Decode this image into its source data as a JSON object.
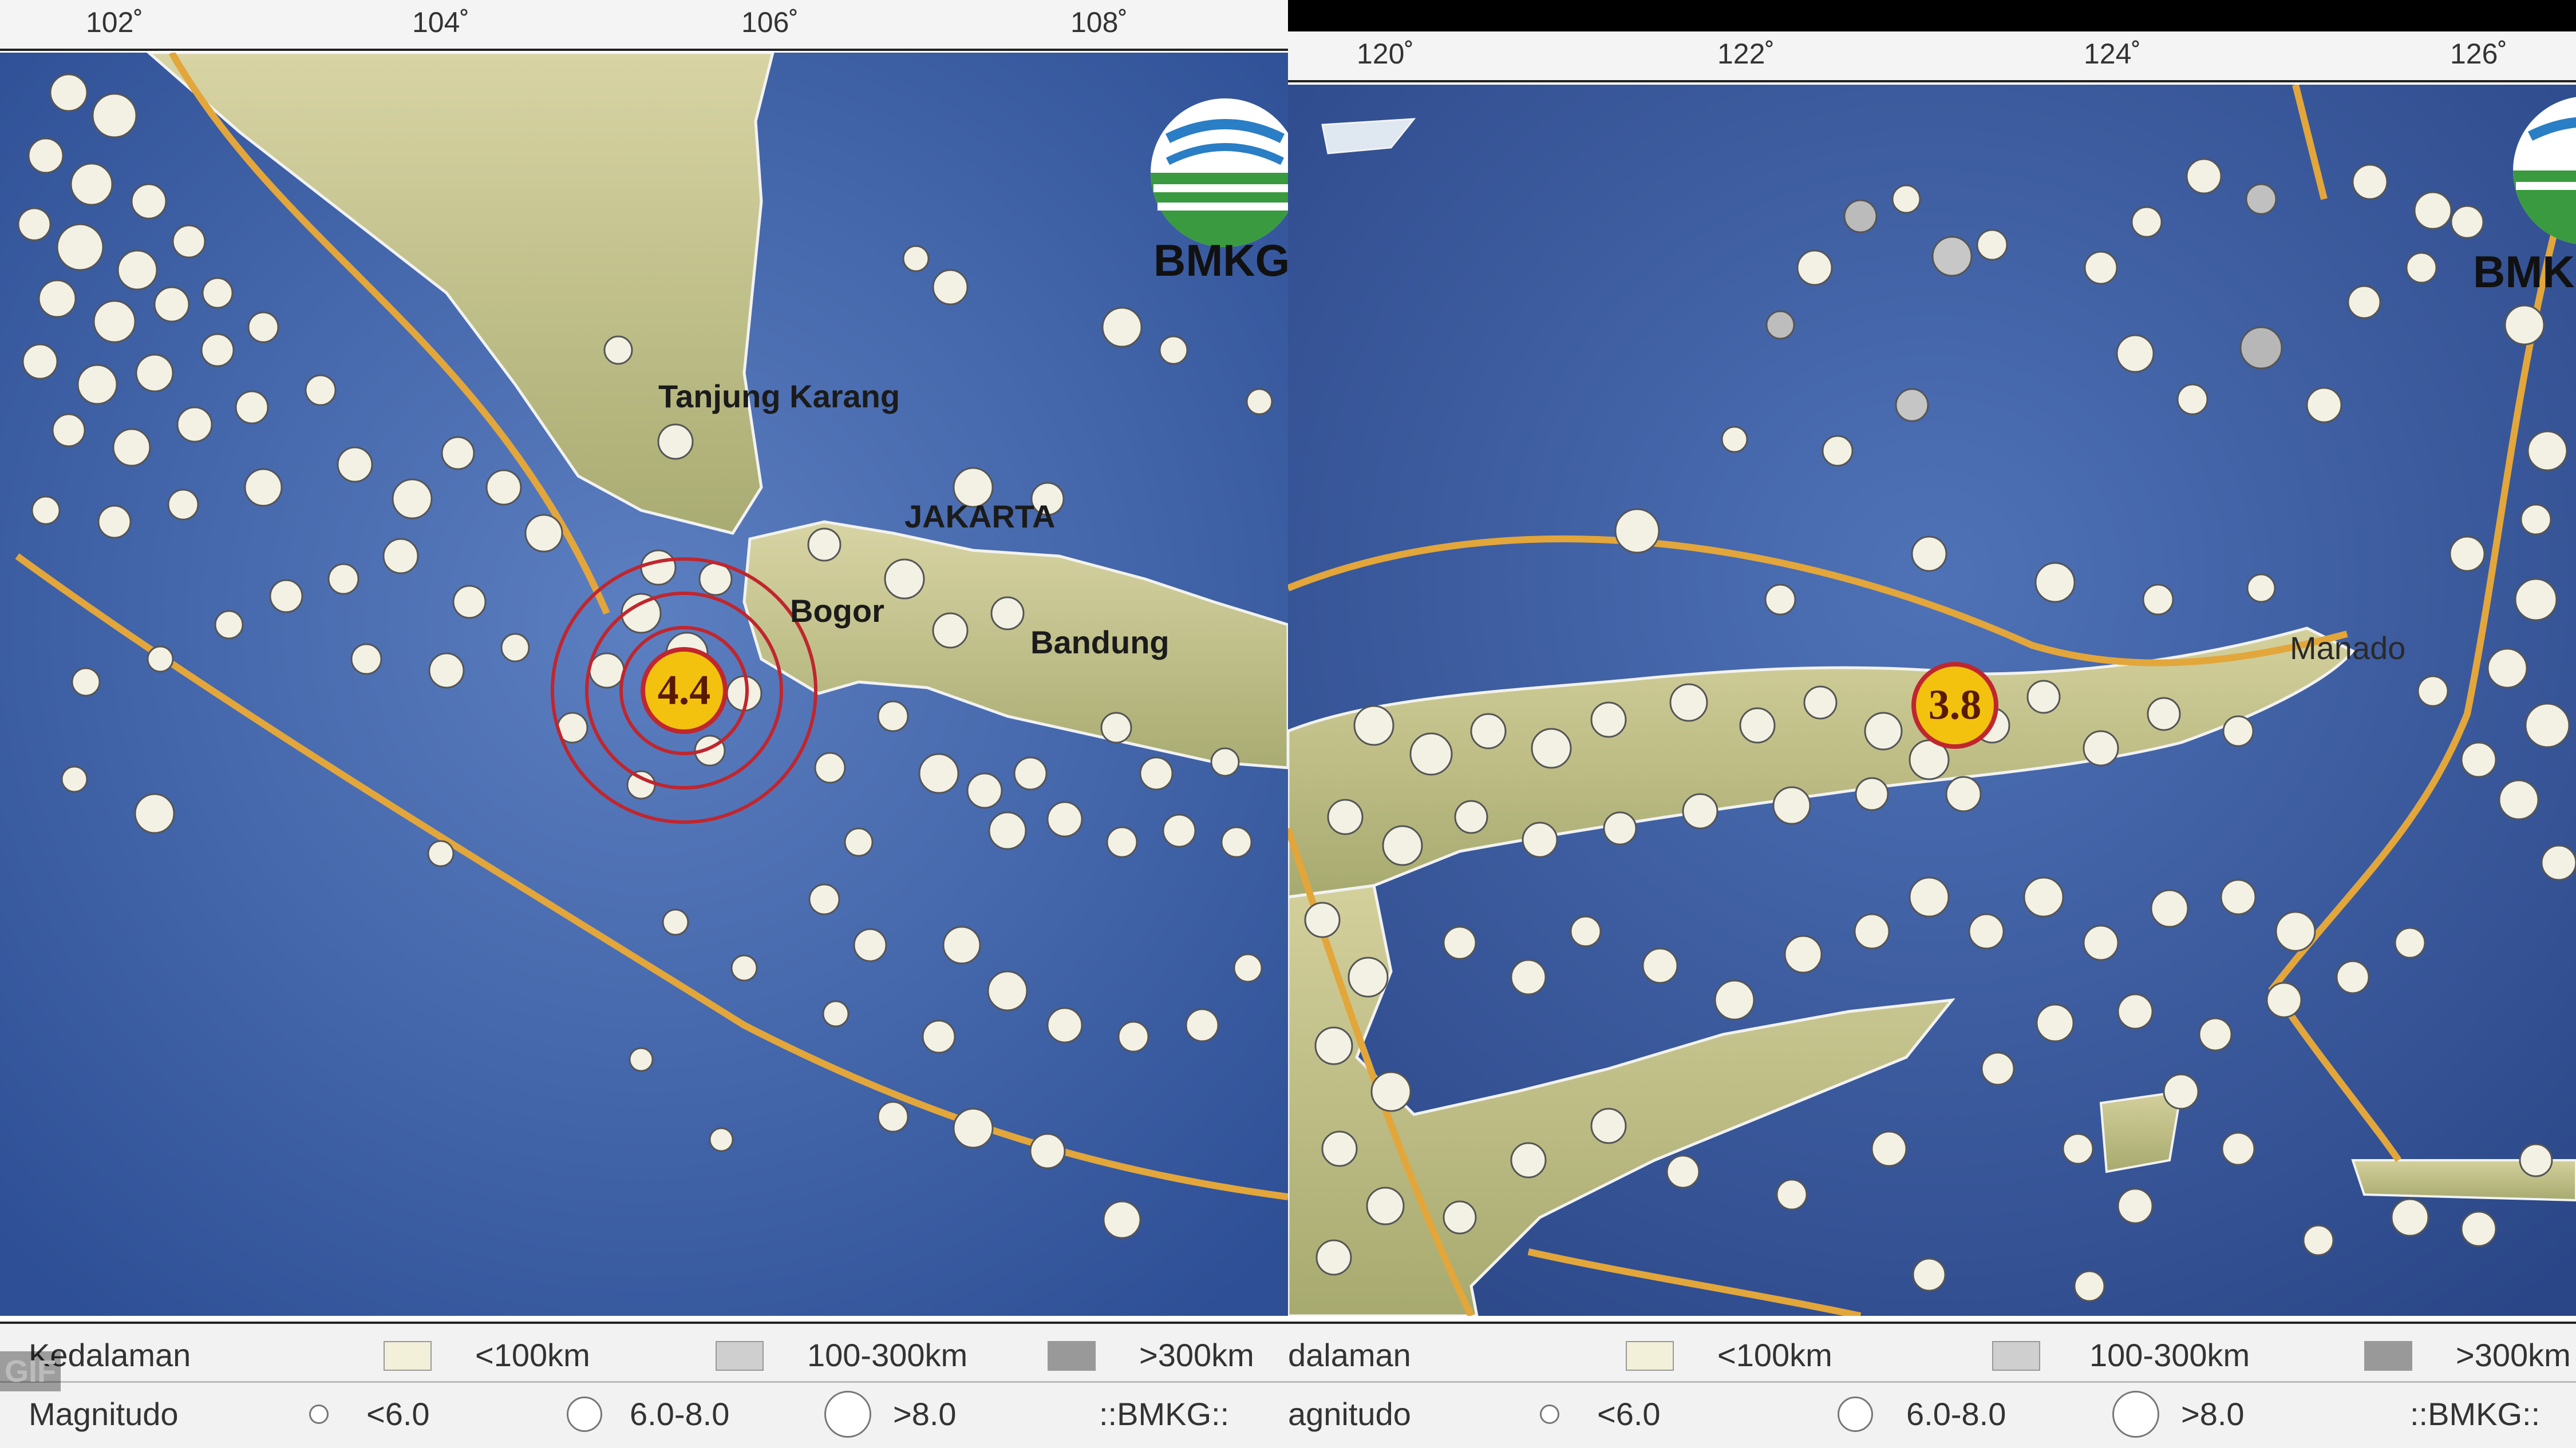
{
  "left_map": {
    "ticks": [
      "102˚",
      "104˚",
      "106˚",
      "108˚"
    ],
    "cities": {
      "tanjung_karang": "Tanjung Karang",
      "jakarta": "JAKARTA",
      "bogor": "Bogor",
      "bandung": "Bandung"
    },
    "magnitude": "4.4",
    "logo_text": "BMKG"
  },
  "right_map": {
    "ticks": [
      "120˚",
      "122˚",
      "124˚",
      "126˚"
    ],
    "cities": {
      "manado": "Manado"
    },
    "magnitude": "3.8",
    "logo_text": "BMKG"
  },
  "legend_left": {
    "depth_label": "Kedalaman",
    "depth_shallow": "<100km",
    "depth_mid": "100-300km",
    "depth_deep": ">300km",
    "magnitude_label": "Magnitudo",
    "mag_small": "<6.0",
    "mag_mid": "6.0-8.0",
    "mag_large": ">8.0",
    "source": "::BMKG::"
  },
  "legend_right": {
    "depth_label": "dalaman",
    "depth_shallow": "<100km",
    "depth_mid": "100-300km",
    "depth_deep": ">300km",
    "magnitude_label": "agnitudo",
    "mag_small": "<6.0",
    "mag_mid": "6.0-8.0",
    "mag_large": ">8.0",
    "source": "::BMKG::"
  },
  "badge": "GIF",
  "colors": {
    "sea": "#3f62a8",
    "land": "#c9c48f",
    "fault": "#e3a63a",
    "epicenter": "#f2c20f",
    "ring": "#c0262e",
    "quake_dot": "#f3f1e4"
  }
}
